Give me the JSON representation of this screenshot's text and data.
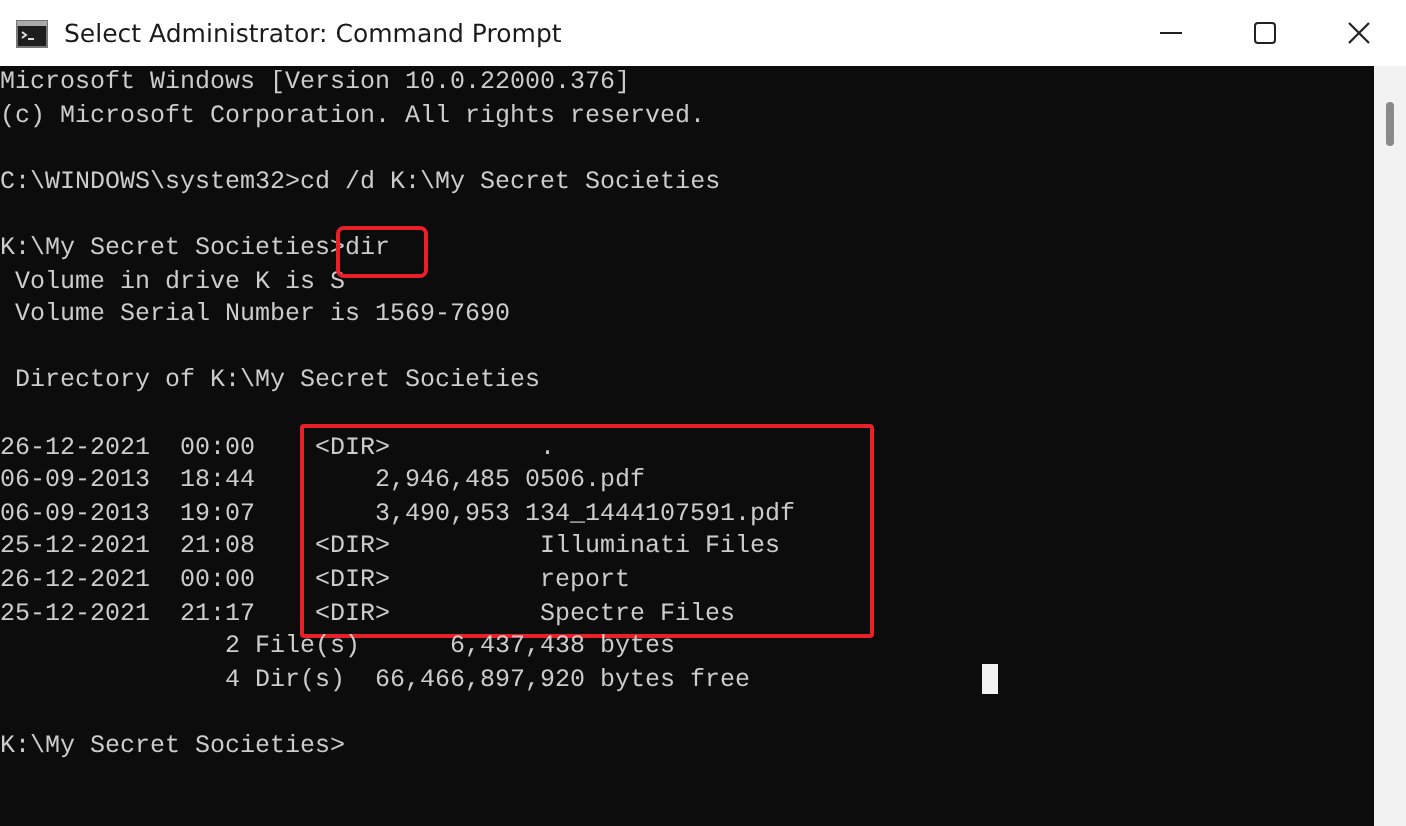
{
  "window": {
    "title": "Select Administrator: Command Prompt"
  },
  "blocks": [
    {
      "kind": "text",
      "lines": [
        "Microsoft Windows [Version 10.0.22000.376]",
        "(c) Microsoft Corporation. All rights reserved."
      ]
    },
    {
      "kind": "command",
      "prompt": "C:\\WINDOWS\\system32>",
      "command": "cd /d K:\\My Secret Societies",
      "highlighted": false
    },
    {
      "kind": "command",
      "prompt": "K:\\My Secret Societies>",
      "command": "dir",
      "highlighted": true,
      "lines": [
        " Volume in drive K is S",
        " Volume Serial Number is 1569-7690"
      ]
    },
    {
      "kind": "text",
      "lines": [
        " Directory of K:\\My Secret Societies"
      ]
    },
    {
      "kind": "listing",
      "highlighted": true,
      "rows": [
        {
          "date": "26-12-2021  00:00",
          "entry": "<DIR>          ."
        },
        {
          "date": "06-09-2013  18:44",
          "entry": "    2,946,485 0506.pdf"
        },
        {
          "date": "06-09-2013  19:07",
          "entry": "    3,490,953 134_1444107591.pdf"
        },
        {
          "date": "25-12-2021  21:08",
          "entry": "<DIR>          Illuminati Files"
        },
        {
          "date": "26-12-2021  00:00",
          "entry": "<DIR>          report"
        },
        {
          "date": "25-12-2021  21:17",
          "entry": "<DIR>          Spectre Files"
        }
      ],
      "summary": [
        "               2 File(s)      6,437,438 bytes",
        "               4 Dir(s)  66,466,897,920 bytes free"
      ]
    },
    {
      "kind": "command",
      "prompt": "K:\\My Secret Societies>",
      "highlighted": false
    }
  ]
}
